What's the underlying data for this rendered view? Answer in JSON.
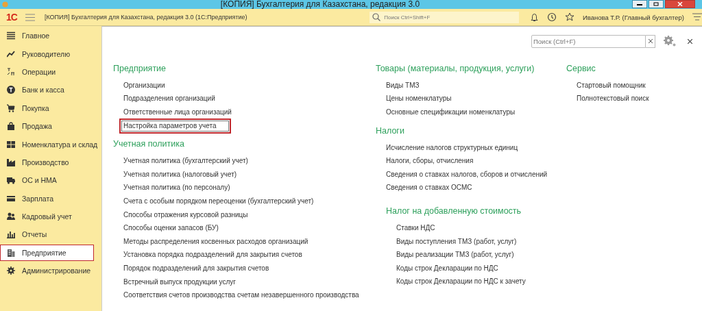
{
  "window": {
    "title": "[КОПИЯ] Бухгалтерия для Казахстана, редакция 3.0"
  },
  "toolbar": {
    "logo": "1С",
    "app_title": "[КОПИЯ] Бухгалтерия для Казахстана, редакция 3.0  (1С:Предприятие)",
    "search": {
      "placeholder": "Поиск Ctrl+Shift+F"
    },
    "user": "Иванова Т.Р. (Главный бухгалтер)"
  },
  "sidebar": {
    "items": [
      {
        "label": "Главное",
        "selected": false
      },
      {
        "label": "Руководителю",
        "selected": false
      },
      {
        "label": "Операции",
        "selected": false
      },
      {
        "label": "Банк и касса",
        "selected": false
      },
      {
        "label": "Покупка",
        "selected": false
      },
      {
        "label": "Продажа",
        "selected": false
      },
      {
        "label": "Номенклатура и склад",
        "selected": false
      },
      {
        "label": "Производство",
        "selected": false
      },
      {
        "label": "ОС и НМА",
        "selected": false
      },
      {
        "label": "Зарплата",
        "selected": false
      },
      {
        "label": "Кадровый учет",
        "selected": false
      },
      {
        "label": "Отчеты",
        "selected": false
      },
      {
        "label": "Предприятие",
        "selected": true
      },
      {
        "label": "Администрирование",
        "selected": false
      }
    ]
  },
  "content": {
    "search": {
      "placeholder": "Поиск (Ctrl+F)"
    },
    "columns": [
      [
        {
          "title": "Предприятие",
          "items": [
            {
              "label": "Организации",
              "highlighted": false
            },
            {
              "label": "Подразделения организаций",
              "highlighted": false
            },
            {
              "label": "Ответственные лица организаций",
              "highlighted": false
            },
            {
              "label": "Настройка параметров учета",
              "highlighted": true
            }
          ]
        },
        {
          "title": "Учетная политика",
          "items": [
            {
              "label": "Учетная политика (бухгалтерский учет)",
              "highlighted": false
            },
            {
              "label": "Учетная политика (налоговый учет)",
              "highlighted": false
            },
            {
              "label": "Учетная политика (по персоналу)",
              "highlighted": false
            },
            {
              "label": "Счета с особым порядком переоценки (бухгалтерский учет)",
              "highlighted": false
            },
            {
              "label": "Способы отражения курсовой разницы",
              "highlighted": false
            },
            {
              "label": "Способы оценки запасов (БУ)",
              "highlighted": false
            },
            {
              "label": "Методы распределения косвенных расходов организаций",
              "highlighted": false
            },
            {
              "label": "Установка порядка подразделений для закрытия счетов",
              "highlighted": false
            },
            {
              "label": "Порядок подразделений для закрытия счетов",
              "highlighted": false
            },
            {
              "label": "Встречный выпуск продукции услуг",
              "highlighted": false
            },
            {
              "label": "Соответствия счетов производства счетам незавершенного производства",
              "highlighted": false
            }
          ]
        }
      ],
      [
        {
          "title": "Товары (материалы, продукция, услуги)",
          "items": [
            {
              "label": "Виды ТМЗ",
              "highlighted": false
            },
            {
              "label": "Цены номенклатуры",
              "highlighted": false
            },
            {
              "label": "Основные спецификации номенклатуры",
              "highlighted": false
            }
          ]
        },
        {
          "title": "Налоги",
          "items": [
            {
              "label": "Исчисление налогов структурных единиц",
              "highlighted": false
            },
            {
              "label": "Налоги, сборы, отчисления",
              "highlighted": false
            },
            {
              "label": "Сведения о ставках налогов, сборов и отчислений",
              "highlighted": false
            },
            {
              "label": "Сведения о ставках ОСМС",
              "highlighted": false
            }
          ],
          "children": [
            {
              "title": "Налог на добавленную стоимость",
              "items": [
                {
                  "label": "Ставки НДС",
                  "highlighted": false
                },
                {
                  "label": "Виды поступления ТМЗ (работ, услуг)",
                  "highlighted": false
                },
                {
                  "label": "Виды реализации ТМЗ (работ, услуг)",
                  "highlighted": false
                },
                {
                  "label": "Коды строк Декларации по НДС",
                  "highlighted": false
                },
                {
                  "label": "Коды строк Декларации по НДС к зачету",
                  "highlighted": false
                }
              ]
            }
          ]
        }
      ],
      [
        {
          "title": "Сервис",
          "items": [
            {
              "label": "Стартовый помощник",
              "highlighted": false
            },
            {
              "label": "Полнотекстовый поиск",
              "highlighted": false
            }
          ]
        }
      ]
    ]
  }
}
